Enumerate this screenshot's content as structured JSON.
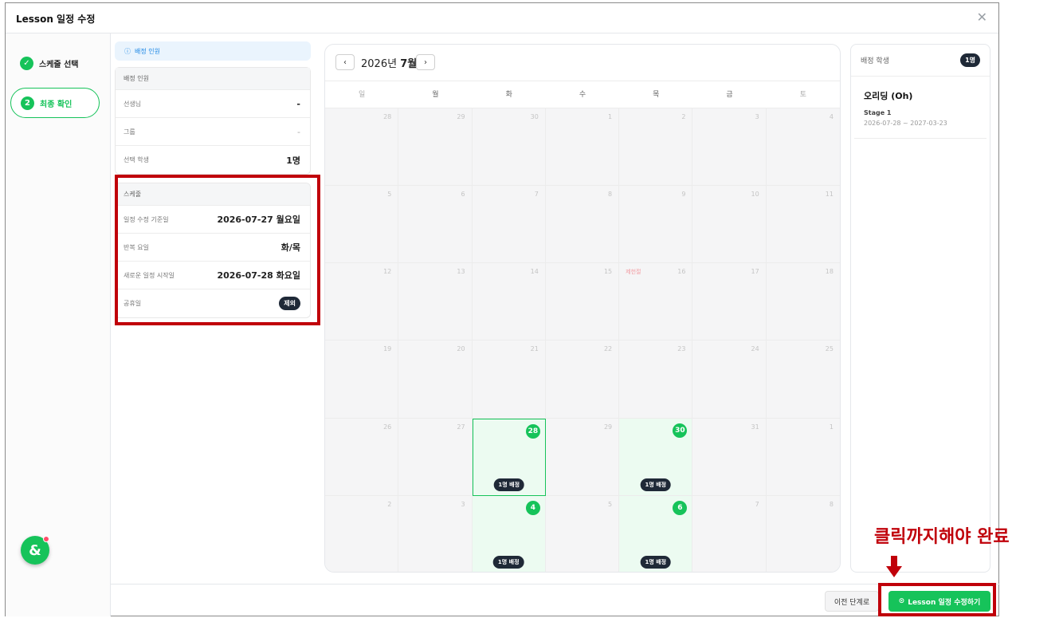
{
  "modal": {
    "title": "Lesson 일정 수정",
    "close_icon": "✕"
  },
  "steps": [
    {
      "number": "✓",
      "label": "스케줄 선택",
      "state": "done"
    },
    {
      "number": "2",
      "label": "최종 확인",
      "state": "active"
    }
  ],
  "info": {
    "alert_icon": "ⓘ",
    "alert_text": "배정 인원",
    "assignment_section": "배정 인원",
    "assignment_rows": [
      {
        "label": "선생님",
        "value": "-"
      },
      {
        "label": "그룹",
        "value": "-"
      },
      {
        "label": "선택 학생",
        "value": "1명"
      }
    ],
    "schedule_section": "스케줄",
    "schedule_rows": [
      {
        "label": "일정 수정 기준일",
        "value": "2026-07-27 월요일"
      },
      {
        "label": "반복 요일",
        "value": "화/목"
      },
      {
        "label": "새로운 일정 시작일",
        "value": "2026-07-28 화요일"
      }
    ],
    "holiday_label": "공휴일",
    "holiday_value": "제외"
  },
  "calendar": {
    "prev_icon": "‹",
    "next_icon": "›",
    "year_text": "2026년",
    "month_text": "7월",
    "weekdays": [
      "일",
      "월",
      "화",
      "수",
      "목",
      "금",
      "토"
    ],
    "holiday_name": "제헌절",
    "assign_label": "1명 배정",
    "weeks": [
      [
        "28",
        "29",
        "30",
        "1",
        "2",
        "3",
        "4"
      ],
      [
        "5",
        "6",
        "7",
        "8",
        "9",
        "10",
        "11"
      ],
      [
        "12",
        "13",
        "14",
        "15",
        "16",
        "17",
        "18"
      ],
      [
        "19",
        "20",
        "21",
        "22",
        "23",
        "24",
        "25"
      ],
      [
        "26",
        "27",
        "28",
        "29",
        "30",
        "31",
        "1"
      ],
      [
        "2",
        "3",
        "4",
        "5",
        "6",
        "7",
        "8"
      ]
    ]
  },
  "student_panel": {
    "title": "배정 학생",
    "count": "1명",
    "student": {
      "name": "오리딩 (Oh)",
      "stage": "Stage 1",
      "period": "2026-07-28 ~ 2027-03-23"
    }
  },
  "footer": {
    "prev_label": "이전 단계로",
    "submit_icon": "⊙",
    "submit_label": "Lesson 일정 수정하기"
  },
  "annotation": {
    "text": "클릭까지해야 완료"
  },
  "fab": {
    "glyph": "&"
  },
  "colors": {
    "accent": "#16c35a",
    "annotation": "#c0000a",
    "dark_pill": "#1f2937"
  }
}
